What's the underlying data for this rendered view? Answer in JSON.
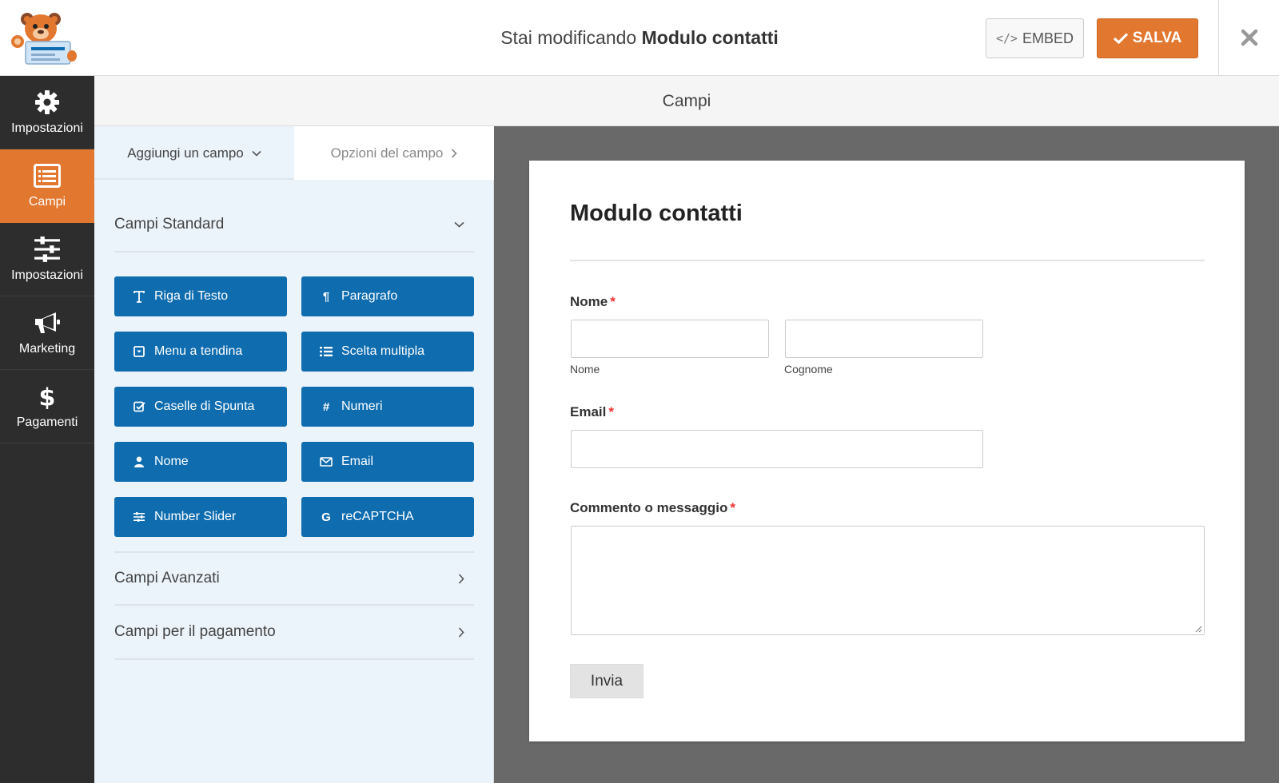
{
  "header": {
    "title_prefix": "Stai modificando",
    "title_form": "Modulo contatti",
    "embed_label": "EMBED",
    "save_label": "SALVA"
  },
  "sidebar": {
    "items": [
      {
        "label": "Impostazioni",
        "icon": "gear-icon"
      },
      {
        "label": "Campi",
        "icon": "fields-icon",
        "active": true
      },
      {
        "label": "Impostazioni",
        "icon": "sliders-icon"
      },
      {
        "label": "Marketing",
        "icon": "megaphone-icon"
      },
      {
        "label": "Pagamenti",
        "icon": "dollar-icon"
      }
    ]
  },
  "subheader": {
    "title": "Campi"
  },
  "panel": {
    "tabs": {
      "add": "Aggiungi un campo",
      "options": "Opzioni del campo"
    },
    "sections": {
      "standard": "Campi Standard",
      "advanced": "Campi Avanzati",
      "payment": "Campi per il pagamento"
    },
    "fields": [
      {
        "label": "Riga di Testo",
        "icon": "text-icon"
      },
      {
        "label": "Paragrafo",
        "icon": "paragraph-icon"
      },
      {
        "label": "Menu a tendina",
        "icon": "dropdown-icon"
      },
      {
        "label": "Scelta multipla",
        "icon": "list-icon"
      },
      {
        "label": "Caselle di Spunta",
        "icon": "checkbox-icon"
      },
      {
        "label": "Numeri",
        "icon": "hash-icon"
      },
      {
        "label": "Nome",
        "icon": "user-icon"
      },
      {
        "label": "Email",
        "icon": "envelope-icon"
      },
      {
        "label": "Number Slider",
        "icon": "sliders-icon"
      },
      {
        "label": "reCAPTCHA",
        "icon": "google-icon"
      }
    ]
  },
  "form": {
    "title": "Modulo contatti",
    "name_label": "Nome",
    "name_first_sub": "Nome",
    "name_last_sub": "Cognome",
    "email_label": "Email",
    "message_label": "Commento o messaggio",
    "required_mark": "*",
    "submit_label": "Invia"
  },
  "colors": {
    "accent": "#e27730",
    "field_button": "#0e6caf",
    "sidebar": "#2d2d2d",
    "canvas": "#696969",
    "panel": "#ebf3fb"
  }
}
